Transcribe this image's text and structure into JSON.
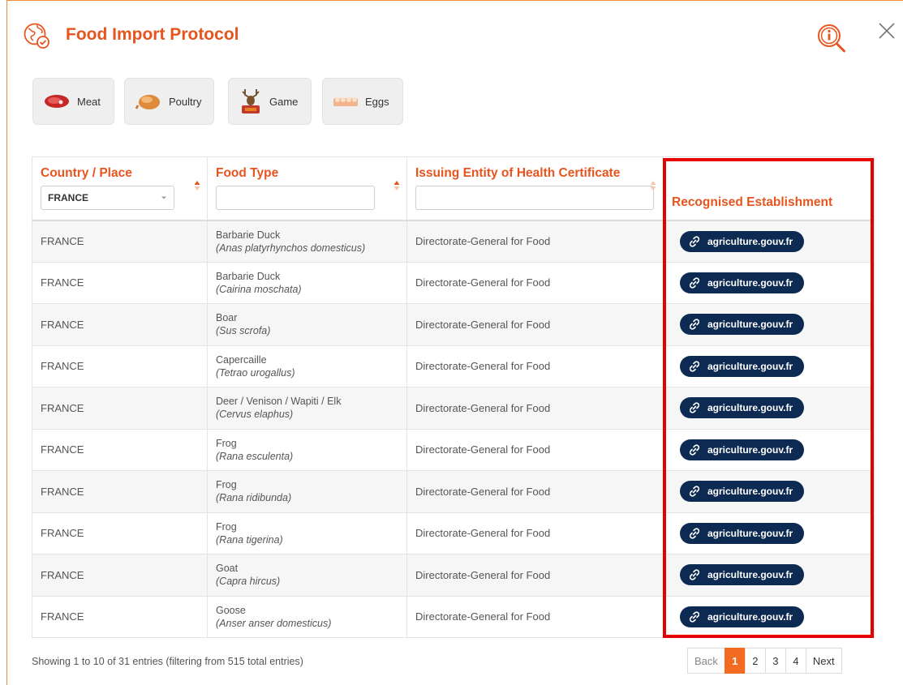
{
  "header": {
    "title": "Food Import Protocol"
  },
  "categories": [
    {
      "label": "Meat",
      "icon": "meat-icon"
    },
    {
      "label": "Poultry",
      "icon": "poultry-icon"
    },
    {
      "label": "Game",
      "icon": "game-deer-icon"
    },
    {
      "label": "Eggs",
      "icon": "eggs-icon"
    }
  ],
  "table": {
    "headers": {
      "country": "Country / Place",
      "food": "Food Type",
      "issuer": "Issuing Entity of Health Certificate",
      "establishment": "Recognised Establishment"
    },
    "country_filter": "FRANCE",
    "food_filter": "",
    "issuer_filter": "",
    "rows": [
      {
        "country": "FRANCE",
        "food": "Barbarie Duck",
        "scientific": "(Anas platyrhynchos domesticus)",
        "issuer": "Directorate-General for Food",
        "link": "agriculture.gouv.fr"
      },
      {
        "country": "FRANCE",
        "food": "Barbarie Duck",
        "scientific": "(Cairina moschata)",
        "issuer": "Directorate-General for Food",
        "link": "agriculture.gouv.fr"
      },
      {
        "country": "FRANCE",
        "food": "Boar",
        "scientific": "(Sus scrofa)",
        "issuer": "Directorate-General for Food",
        "link": "agriculture.gouv.fr"
      },
      {
        "country": "FRANCE",
        "food": "Capercaille",
        "scientific": "(Tetrao urogallus)",
        "issuer": "Directorate-General for Food",
        "link": "agriculture.gouv.fr"
      },
      {
        "country": "FRANCE",
        "food": "Deer / Venison / Wapiti / Elk",
        "scientific": "(Cervus elaphus)",
        "issuer": "Directorate-General for Food",
        "link": "agriculture.gouv.fr"
      },
      {
        "country": "FRANCE",
        "food": "Frog",
        "scientific": "(Rana esculenta)",
        "issuer": "Directorate-General for Food",
        "link": "agriculture.gouv.fr"
      },
      {
        "country": "FRANCE",
        "food": "Frog",
        "scientific": "(Rana ridibunda)",
        "issuer": "Directorate-General for Food",
        "link": "agriculture.gouv.fr"
      },
      {
        "country": "FRANCE",
        "food": "Frog",
        "scientific": "(Rana tigerina)",
        "issuer": "Directorate-General for Food",
        "link": "agriculture.gouv.fr"
      },
      {
        "country": "FRANCE",
        "food": "Goat",
        "scientific": "(Capra hircus)",
        "issuer": "Directorate-General for Food",
        "link": "agriculture.gouv.fr"
      },
      {
        "country": "FRANCE",
        "food": "Goose",
        "scientific": "(Anser anser domesticus)",
        "issuer": "Directorate-General for Food",
        "link": "agriculture.gouv.fr"
      }
    ]
  },
  "footer": {
    "info": "Showing 1 to 10 of 31 entries (filtering from 515 total entries)",
    "pagination": {
      "back": "Back",
      "pages": [
        "1",
        "2",
        "3",
        "4"
      ],
      "current": "1",
      "next": "Next"
    }
  },
  "colors": {
    "accent": "#e8541e",
    "pill": "#0d2a52",
    "highlight": "#e60000",
    "active_page": "#f26b21"
  }
}
